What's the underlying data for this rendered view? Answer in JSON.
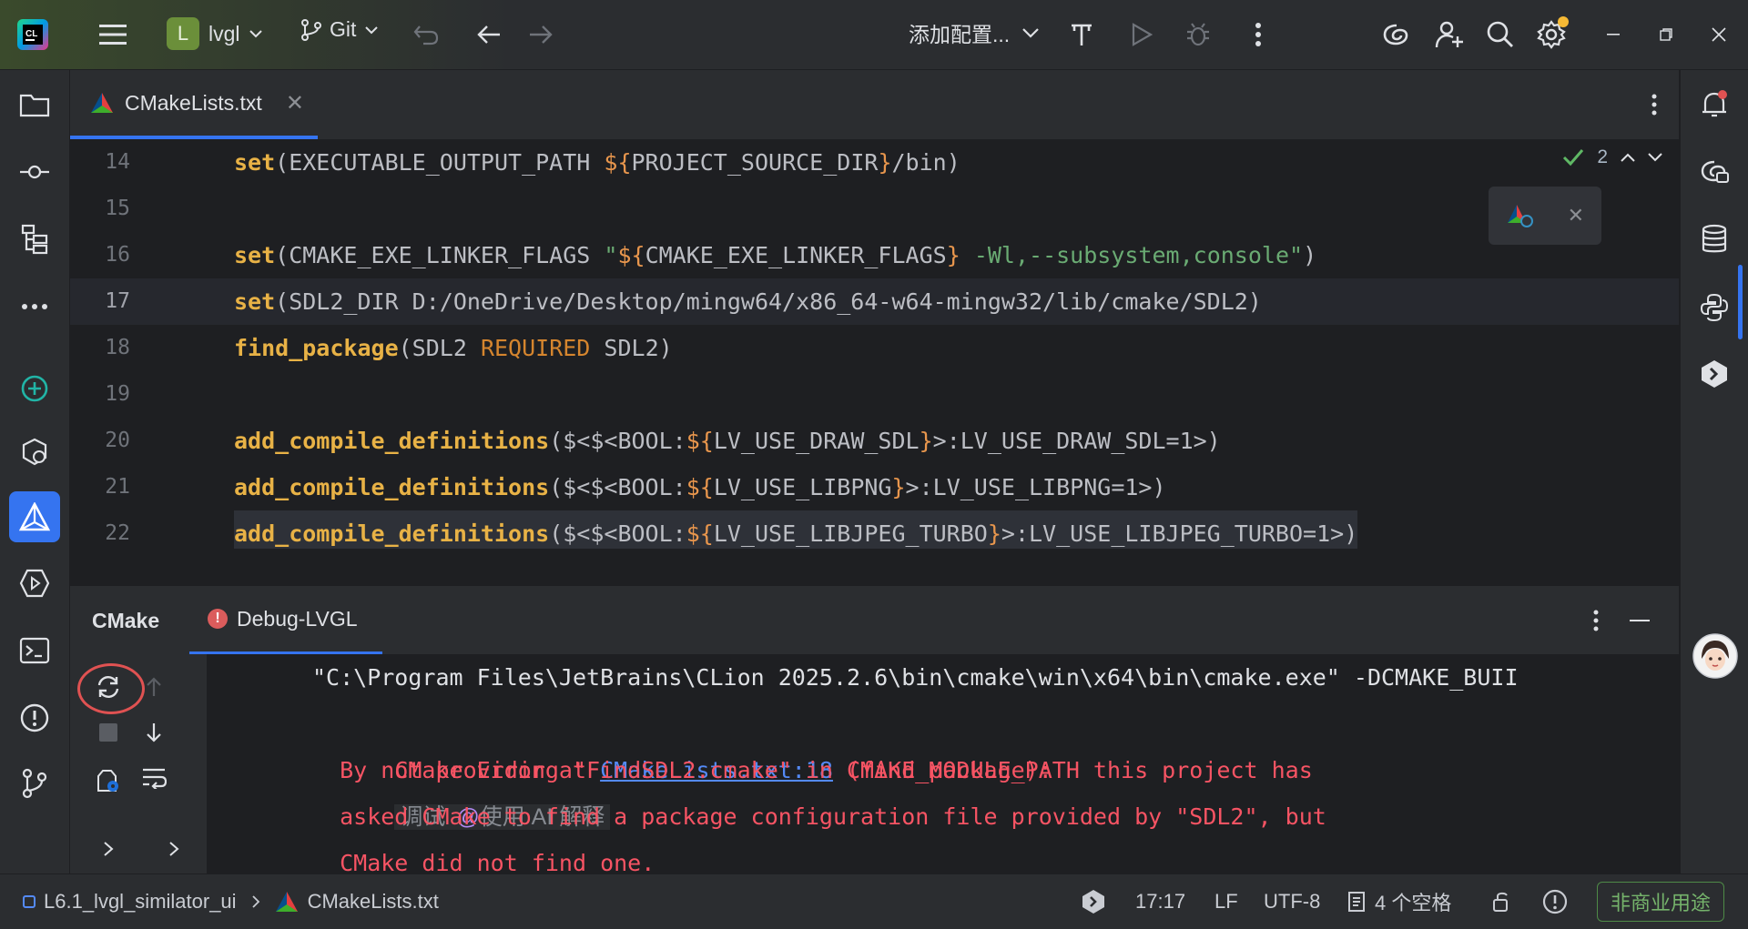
{
  "titlebar": {
    "project_initial": "L",
    "project_name": "lvgl",
    "vcs_label": "Git",
    "run_config": "添加配置..."
  },
  "editor": {
    "tab_label": "CMakeLists.txt",
    "inspection_count": "2",
    "lines": [
      {
        "num": "14",
        "text": "set(EXECUTABLE_OUTPUT_PATH ${PROJECT_SOURCE_DIR}/bin)"
      },
      {
        "num": "15",
        "text": ""
      },
      {
        "num": "16",
        "text": "set(CMAKE_EXE_LINKER_FLAGS \"${CMAKE_EXE_LINKER_FLAGS} -Wl,--subsystem,console\")"
      },
      {
        "num": "17",
        "text": "set(SDL2_DIR D:/OneDrive/Desktop/mingw64/x86_64-w64-mingw32/lib/cmake/SDL2)"
      },
      {
        "num": "18",
        "text": "find_package(SDL2 REQUIRED SDL2)"
      },
      {
        "num": "19",
        "text": ""
      },
      {
        "num": "20",
        "text": "add_compile_definitions($<$<BOOL:${LV_USE_DRAW_SDL}>:LV_USE_DRAW_SDL=1>)"
      },
      {
        "num": "21",
        "text": "add_compile_definitions($<$<BOOL:${LV_USE_LIBPNG}>:LV_USE_LIBPNG=1>)"
      },
      {
        "num": "22",
        "text": "add_compile_definitions($<$<BOOL:${LV_USE_LIBJPEG_TURBO}>:LV_USE_LIBJPEG_TURBO=1>)"
      }
    ]
  },
  "toolwindow": {
    "title": "CMake",
    "tab_label": "Debug-LVGL",
    "console": {
      "command": "\"C:\\Program Files\\JetBrains\\CLion 2025.2.6\\bin\\cmake\\win\\x64\\bin\\cmake.exe\" -DCMAKE_BUII",
      "error_prefix": "CMake Error at ",
      "error_link": "CMakeLists.txt:18",
      "error_suffix": " (find_package):",
      "hint_debug": "调试",
      "hint_ai": "使用 AI 解释",
      "msg_line1": "  By not providing \"FindSDL2.cmake\" in CMAKE_MODULE_PATH this project has",
      "msg_line2": "  asked CMake to find a package configuration file provided by \"SDL2\", but",
      "msg_line3": "  CMake did not find one."
    }
  },
  "statusbar": {
    "breadcrumb_project": "L6.1_lvgl_similator_ui",
    "breadcrumb_file": "CMakeLists.txt",
    "position": "17:17",
    "line_separator": "LF",
    "encoding": "UTF-8",
    "indent": "4 个空格",
    "license": "非商业用途"
  },
  "colors": {
    "accent": "#3574f0",
    "error": "#f75464",
    "keyword": "#e8b246",
    "string": "#6aab73",
    "license": "#75b36b"
  }
}
